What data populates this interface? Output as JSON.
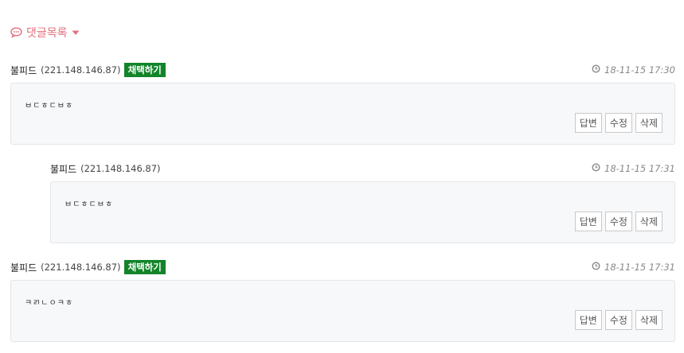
{
  "header": {
    "title": "댓글목록",
    "accent": "#e0707e"
  },
  "comments": [
    {
      "author": "불피드",
      "ip": "(221.148.146.87)",
      "adopt": "채택하기",
      "time": "18-11-15 17:30",
      "text": "ㅂㄷㅎㄷㅂㅎ",
      "actions": [
        "답변",
        "수정",
        "삭제"
      ]
    },
    {
      "author": "불피드",
      "ip": "(221.148.146.87)",
      "time": "18-11-15 17:31",
      "text": "ㅂㄷㅎㄷㅂㅎ",
      "actions": [
        "답변",
        "수정",
        "삭제"
      ]
    },
    {
      "author": "불피드",
      "ip": "(221.148.146.87)",
      "adopt": "채택하기",
      "time": "18-11-15 17:31",
      "text": "ㅋㄺㄴㅇㅋㅎ",
      "actions": [
        "답변",
        "수정",
        "삭제"
      ]
    }
  ],
  "colors": {
    "adopt_bg": "#13842a",
    "body_bg": "#f7f8fa"
  }
}
